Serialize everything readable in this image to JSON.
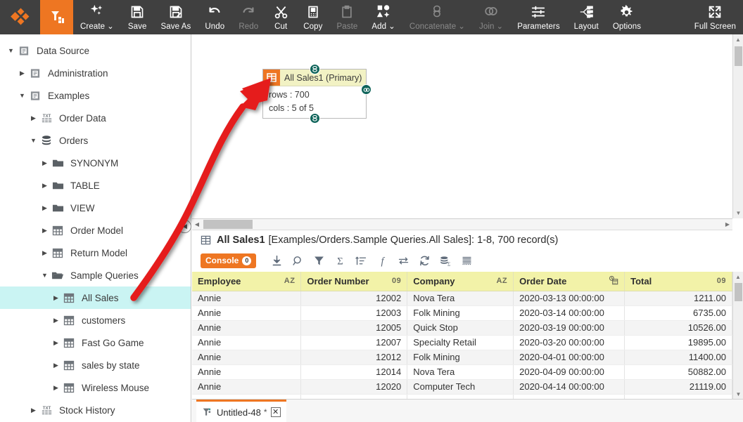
{
  "toolbar": {
    "logo_icon": "app-logo-icon",
    "active_icon": "data-flow-icon",
    "items": [
      {
        "label": "Create",
        "icon": "sparkles-icon",
        "enabled": true,
        "dropdown": true
      },
      {
        "label": "Save",
        "icon": "floppy-icon",
        "enabled": true,
        "dropdown": false
      },
      {
        "label": "Save As",
        "icon": "floppy-pen-icon",
        "enabled": true,
        "dropdown": false
      },
      {
        "label": "Undo",
        "icon": "undo-arrow-icon",
        "enabled": true,
        "dropdown": false
      },
      {
        "label": "Redo",
        "icon": "redo-arrow-icon",
        "enabled": false,
        "dropdown": false
      },
      {
        "label": "Cut",
        "icon": "scissors-icon",
        "enabled": true,
        "dropdown": false
      },
      {
        "label": "Copy",
        "icon": "clipboard-copy-icon",
        "enabled": true,
        "dropdown": false
      },
      {
        "label": "Paste",
        "icon": "clipboard-icon",
        "enabled": false,
        "dropdown": false
      },
      {
        "label": "Add",
        "icon": "shapes-plus-icon",
        "enabled": true,
        "dropdown": true
      },
      {
        "label": "Concatenate",
        "icon": "concatenate-icon",
        "enabled": false,
        "dropdown": true
      },
      {
        "label": "Join",
        "icon": "venn-join-icon",
        "enabled": false,
        "dropdown": true
      },
      {
        "label": "Parameters",
        "icon": "sliders-icon",
        "enabled": true,
        "dropdown": false
      },
      {
        "label": "Layout",
        "icon": "layout-tree-icon",
        "enabled": true,
        "dropdown": false
      },
      {
        "label": "Options",
        "icon": "gear-icon",
        "enabled": true,
        "dropdown": false
      },
      {
        "label": "Full Screen",
        "icon": "expand-icon",
        "enabled": true,
        "dropdown": false
      }
    ]
  },
  "sidebar": {
    "items": [
      {
        "label": "Data Source",
        "indent": 0,
        "twisty": "down",
        "icon": "datasource-icon",
        "selected": false
      },
      {
        "label": "Administration",
        "indent": 1,
        "twisty": "right",
        "icon": "datasource-icon",
        "selected": false
      },
      {
        "label": "Examples",
        "indent": 1,
        "twisty": "down",
        "icon": "datasource-icon",
        "selected": false
      },
      {
        "label": "Order Data",
        "indent": 2,
        "twisty": "right",
        "icon": "txt-file-icon",
        "selected": false
      },
      {
        "label": "Orders",
        "indent": 2,
        "twisty": "down",
        "icon": "database-icon",
        "selected": false
      },
      {
        "label": "SYNONYM",
        "indent": 3,
        "twisty": "right",
        "icon": "folder-icon",
        "selected": false
      },
      {
        "label": "TABLE",
        "indent": 3,
        "twisty": "right",
        "icon": "folder-icon",
        "selected": false
      },
      {
        "label": "VIEW",
        "indent": 3,
        "twisty": "right",
        "icon": "folder-icon",
        "selected": false
      },
      {
        "label": "Order Model",
        "indent": 3,
        "twisty": "right",
        "icon": "table-grid-icon",
        "selected": false
      },
      {
        "label": "Return Model",
        "indent": 3,
        "twisty": "right",
        "icon": "table-grid-icon",
        "selected": false
      },
      {
        "label": "Sample Queries",
        "indent": 3,
        "twisty": "down",
        "icon": "folder-open-icon",
        "selected": false
      },
      {
        "label": "All Sales",
        "indent": 4,
        "twisty": "right",
        "icon": "table-grid-icon",
        "selected": true
      },
      {
        "label": "customers",
        "indent": 4,
        "twisty": "right",
        "icon": "table-grid-icon",
        "selected": false
      },
      {
        "label": "Fast Go Game",
        "indent": 4,
        "twisty": "right",
        "icon": "table-grid-icon",
        "selected": false
      },
      {
        "label": "sales by state",
        "indent": 4,
        "twisty": "right",
        "icon": "table-grid-icon",
        "selected": false
      },
      {
        "label": "Wireless Mouse",
        "indent": 4,
        "twisty": "right",
        "icon": "table-grid-icon",
        "selected": false
      },
      {
        "label": "Stock History",
        "indent": 2,
        "twisty": "right",
        "icon": "txt-file-icon",
        "selected": false
      }
    ]
  },
  "canvas": {
    "node": {
      "icon": "table-node-icon",
      "title": "All Sales1 (Primary)",
      "rows_line": "rows : 700",
      "cols_line": "cols : 5 of 5",
      "ports": [
        "top-port",
        "bottom-port",
        "left-port",
        "right-port"
      ]
    },
    "annotation": {
      "type": "red-curved-arrow",
      "color": "#E51B1B"
    }
  },
  "results": {
    "title_name": "All Sales1",
    "title_path": "[Examples/Orders.Sample Queries.All Sales]: 1-8, 700 record(s)",
    "console_label": "Console",
    "console_count": "0",
    "tools": [
      {
        "name": "download-icon",
        "glyph": "export"
      },
      {
        "name": "search-icon",
        "glyph": "search"
      },
      {
        "name": "filter-icon",
        "glyph": "filter"
      },
      {
        "name": "sum-icon",
        "glyph": "sigma"
      },
      {
        "name": "sort-icon",
        "glyph": "sort"
      },
      {
        "name": "function-icon",
        "glyph": "fx"
      },
      {
        "name": "swap-columns-icon",
        "glyph": "swap"
      },
      {
        "name": "refresh-icon",
        "glyph": "refresh"
      },
      {
        "name": "aggregate-db-icon",
        "glyph": "db-sigma"
      },
      {
        "name": "rows-icon",
        "glyph": "rows"
      }
    ]
  },
  "grid": {
    "columns": [
      {
        "label": "Employee",
        "type_mark": "AZ",
        "align": "left"
      },
      {
        "label": "Order Number",
        "type_mark": "09",
        "align": "right"
      },
      {
        "label": "Company",
        "type_mark": "AZ",
        "align": "left"
      },
      {
        "label": "Order Date",
        "type_mark": "date-icon",
        "align": "left"
      },
      {
        "label": "Total",
        "type_mark": "09",
        "align": "right"
      }
    ],
    "rows": [
      [
        "Annie",
        "12002",
        "Nova Tera",
        "2020-03-13 00:00:00",
        "1211.00"
      ],
      [
        "Annie",
        "12003",
        "Folk Mining",
        "2020-03-14 00:00:00",
        "6735.00"
      ],
      [
        "Annie",
        "12005",
        "Quick Stop",
        "2020-03-19 00:00:00",
        "10526.00"
      ],
      [
        "Annie",
        "12007",
        "Specialty Retail",
        "2020-03-20 00:00:00",
        "19895.00"
      ],
      [
        "Annie",
        "12012",
        "Folk Mining",
        "2020-04-01 00:00:00",
        "11400.00"
      ],
      [
        "Annie",
        "12014",
        "Nova Tera",
        "2020-04-09 00:00:00",
        "50882.00"
      ],
      [
        "Annie",
        "12020",
        "Computer Tech",
        "2020-04-14 00:00:00",
        "21119.00"
      ]
    ]
  },
  "tabbar": {
    "tab_icon": "flow-tab-icon",
    "tab_label": "Untitled-48",
    "modified_mark": "*",
    "close_label": "✕"
  },
  "colors": {
    "accent_orange": "#EE7622",
    "toolbar_bg": "#404040",
    "selection_cyan": "#CAF4F3",
    "header_yellow": "#F2F2A8",
    "node_title_yellow": "#F2F2C4",
    "port_teal": "#0D6359",
    "arrow_red": "#E51B1B"
  }
}
